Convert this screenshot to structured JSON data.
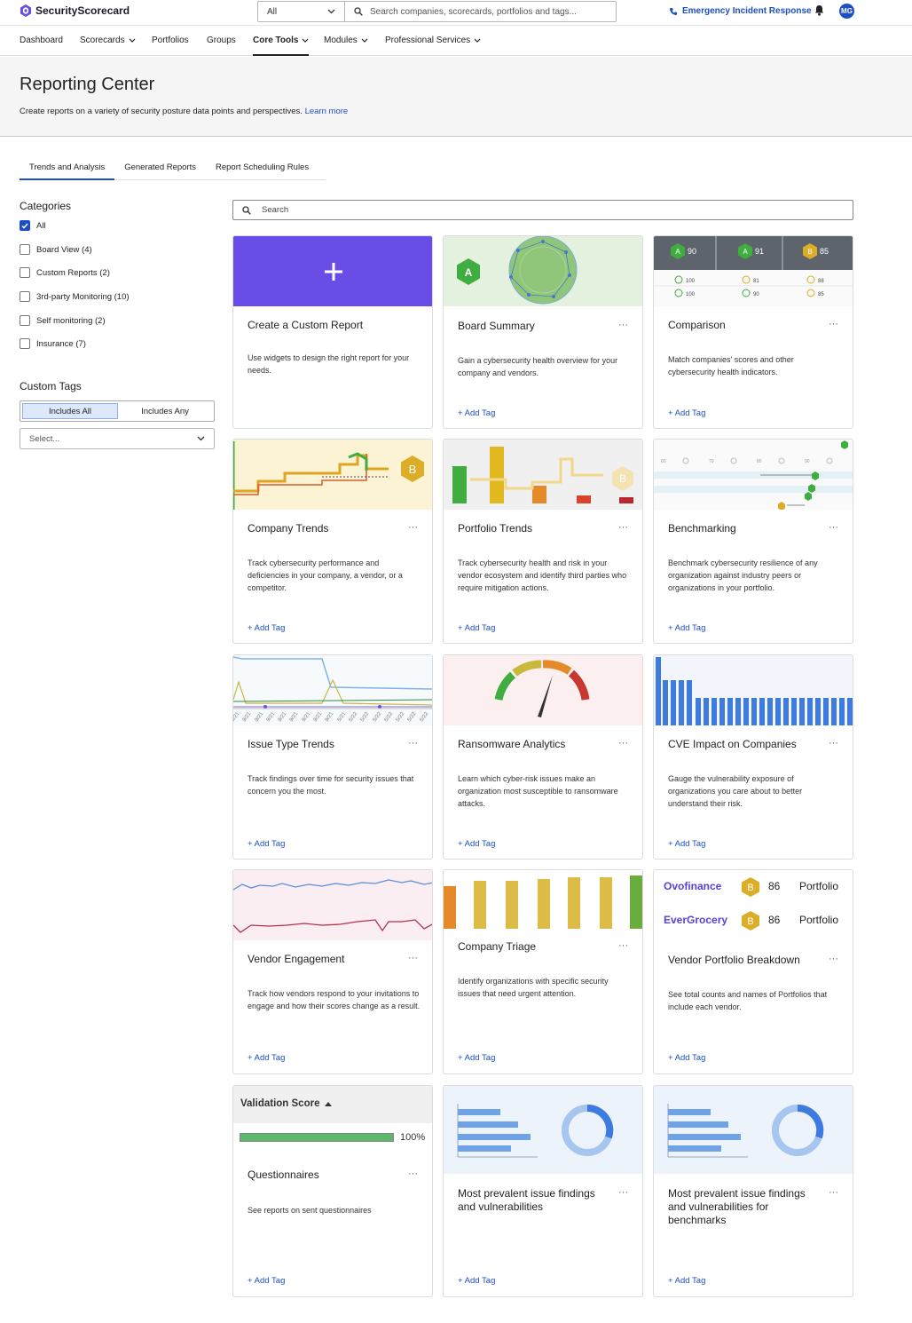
{
  "topbar": {
    "brand": "SecurityScorecard",
    "filter_value": "All",
    "search_placeholder": "Search companies, scorecards, portfolios and tags...",
    "emergency_label": "Emergency Incident Response",
    "avatar_initials": "MG",
    "icons": [
      "logo-icon",
      "chevron-down-icon",
      "search-icon",
      "phone-icon",
      "bell-icon"
    ]
  },
  "nav": {
    "items": [
      {
        "label": "Dashboard",
        "dropdown": false
      },
      {
        "label": "Scorecards",
        "dropdown": true
      },
      {
        "label": "Portfolios",
        "dropdown": false
      },
      {
        "label": "Groups",
        "dropdown": false
      },
      {
        "label": "Core Tools",
        "dropdown": true,
        "active": true
      },
      {
        "label": "Modules",
        "dropdown": true
      },
      {
        "label": "Professional Services",
        "dropdown": true
      }
    ]
  },
  "header": {
    "title": "Reporting Center",
    "subtitle": "Create reports on a variety of security posture data points and perspectives.",
    "learn_more": "Learn more"
  },
  "tabs": [
    {
      "label": "Trends and Analysis",
      "active": true
    },
    {
      "label": "Generated Reports",
      "active": false
    },
    {
      "label": "Report Scheduling Rules",
      "active": false
    }
  ],
  "sidebar": {
    "categories_heading": "Categories",
    "categories": [
      {
        "label": "All",
        "checked": true
      },
      {
        "label": "Board View (4)",
        "checked": false
      },
      {
        "label": "Custom Reports (2)",
        "checked": false
      },
      {
        "label": "3rd-party Monitoring (10)",
        "checked": false
      },
      {
        "label": "Self monitoring (2)",
        "checked": false
      },
      {
        "label": "Insurance (7)",
        "checked": false
      }
    ],
    "tags_heading": "Custom Tags",
    "includes_all": "Includes All",
    "includes_any": "Includes Any",
    "select_placeholder": "Select..."
  },
  "search": {
    "placeholder": "Search"
  },
  "add_tag_label": "+ Add Tag",
  "menu_label": "···",
  "cards": [
    {
      "title": "Create a Custom Report",
      "desc": "Use widgets to design the right report for your needs.",
      "has_tag": false,
      "has_menu": false
    },
    {
      "title": "Board Summary",
      "desc": "Gain a cybersecurity health overview for your company and vendors.",
      "has_tag": true,
      "has_menu": true
    },
    {
      "title": "Comparison",
      "desc": "Match companies' scores and other cybersecurity health indicators.",
      "has_tag": true,
      "has_menu": true
    },
    {
      "title": "Company Trends",
      "desc": "Track cybersecurity performance and deficiencies in your company, a vendor, or a competitor.",
      "has_tag": true,
      "has_menu": true
    },
    {
      "title": "Portfolio Trends",
      "desc": "Track cybersecurity health and risk in your vendor ecosystem and identify third parties who require mitigation actions.",
      "has_tag": true,
      "has_menu": true
    },
    {
      "title": "Benchmarking",
      "desc": "Benchmark cybersecurity resilience of any organization against industry peers or organizations in your portfolio.",
      "has_tag": true,
      "has_menu": true
    },
    {
      "title": "Issue Type Trends",
      "desc": "Track findings over time for security issues that concern you the most.",
      "has_tag": true,
      "has_menu": true
    },
    {
      "title": "Ransomware Analytics",
      "desc": "Learn which cyber-risk issues make an organization most susceptible to ransomware attacks.",
      "has_tag": true,
      "has_menu": true
    },
    {
      "title": "CVE Impact on Companies",
      "desc": "Gauge the vulnerability exposure of organizations you care about to better understand their risk.",
      "has_tag": true,
      "has_menu": true
    },
    {
      "title": "Vendor Engagement",
      "desc": "Track how vendors respond to your invitations to engage and how their scores change as a result.",
      "has_tag": true,
      "has_menu": true
    },
    {
      "title": "Company Triage",
      "desc": "Identify organizations with specific security issues that need urgent attention.",
      "has_tag": true,
      "has_menu": true
    },
    {
      "title": "Vendor Portfolio Breakdown",
      "desc": "See total counts and names of Portfolios that include each vendor.",
      "has_tag": true,
      "has_menu": true
    },
    {
      "title": "Questionnaires",
      "desc": "See reports on sent questionnaires",
      "has_tag": true,
      "has_menu": true
    },
    {
      "title": "Most prevalent issue findings and vulnerabilities",
      "desc": "",
      "has_tag": true,
      "has_menu": true
    },
    {
      "title": "Most prevalent issue findings and vulnerabilities for benchmarks",
      "desc": "",
      "has_tag": true,
      "has_menu": true
    }
  ],
  "previews": {
    "board_grade": "A",
    "comparison": {
      "columns": [
        {
          "grade": "A",
          "score": "90",
          "rows": [
            "100",
            "100"
          ]
        },
        {
          "grade": "A",
          "score": "91",
          "rows": [
            "81",
            "90"
          ]
        },
        {
          "grade": "B",
          "score": "85",
          "rows": [
            "88",
            "85"
          ]
        }
      ]
    },
    "company_trends_grade": "B",
    "portfolio_trends_grade": "B",
    "benchmark_ticks": [
      "60",
      "70",
      "80",
      "90"
    ],
    "issue_dates": [
      "9/21",
      "9/21",
      "9/21",
      "9/21",
      "9/21",
      "9/21",
      "9/21",
      "9/21",
      "9/21",
      "5/21",
      "5/22",
      "5/22",
      "5/22",
      "5/22",
      "5/22",
      "5/22",
      "5/22"
    ],
    "vendor_breakdown": [
      {
        "name": "Ovofinance",
        "grade": "B",
        "score": "86",
        "type": "Portfolio"
      },
      {
        "name": "EverGrocery",
        "grade": "B",
        "score": "86",
        "type": "Portfolio"
      }
    ],
    "validation": {
      "title": "Validation Score",
      "percent": "100%",
      "fraction": 1.0
    },
    "colors": {
      "accent": "#1d4fc4",
      "purple": "#6a4ce6",
      "gradeA": "#3fad3f",
      "gradeB": "#dcad26"
    }
  }
}
